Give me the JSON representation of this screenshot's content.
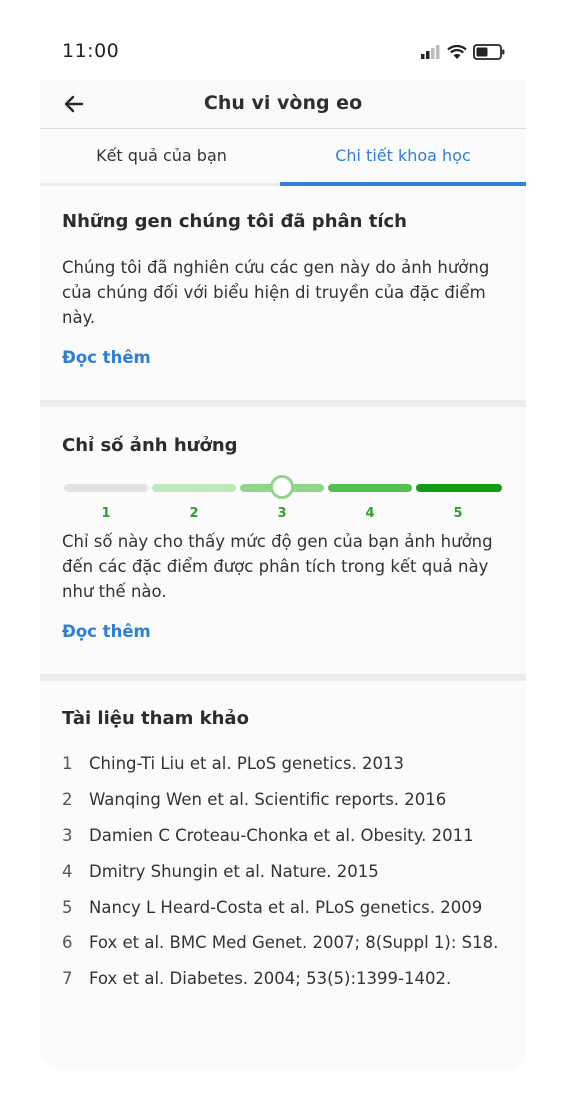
{
  "status": {
    "time": "11:00"
  },
  "app_bar": {
    "title": "Chu vi vòng eo"
  },
  "tabs": [
    {
      "label": "Kết quả của bạn"
    },
    {
      "label": "Chi tiết khoa học"
    }
  ],
  "genes_section": {
    "title": "Những gen chúng tôi đã phân tích",
    "lines": [
      "Chúng tôi đã nghiên cứu các gen này do ảnh hưởng",
      "của chúng đối với biểu hiện di truyền của đặc điểm",
      "này."
    ],
    "read_more": "Đọc thêm"
  },
  "impact_section": {
    "title": "Chỉ số ảnh hưởng",
    "scale_labels": [
      "1",
      "2",
      "3",
      "4",
      "5"
    ],
    "current_level": 3,
    "scale_colors": [
      "#e2e2e2",
      "#bfe8bb",
      "#8fd68a",
      "#55c04f",
      "#139b13"
    ],
    "lines": [
      "Chỉ số này cho thấy mức độ gen của bạn ảnh hưởng",
      "đến các đặc điểm được phân tích trong kết quả này",
      "như thế nào."
    ],
    "read_more": "Đọc thêm"
  },
  "references": {
    "title": "Tài liệu tham khảo",
    "items": [
      {
        "num": "1",
        "text": "Ching-Ti Liu et al. PLoS genetics. 2013"
      },
      {
        "num": "2",
        "text": "Wanqing Wen et al. Scientific reports. 2016"
      },
      {
        "num": "3",
        "text": "Damien C Croteau-Chonka et al. Obesity. 2011"
      },
      {
        "num": "4",
        "text": "Dmitry Shungin et al. Nature. 2015"
      },
      {
        "num": "5",
        "text": "Nancy L Heard-Costa et al. PLoS genetics. 2009"
      },
      {
        "num": "6",
        "text": "Fox et al. BMC Med Genet. 2007; 8(Suppl 1): S18."
      },
      {
        "num": "7",
        "text": "Fox et al. Diabetes. 2004; 53(5):1399-1402."
      }
    ]
  },
  "colors": {
    "accent": "#2f7fd6",
    "scale_green": "#2ea12a"
  }
}
